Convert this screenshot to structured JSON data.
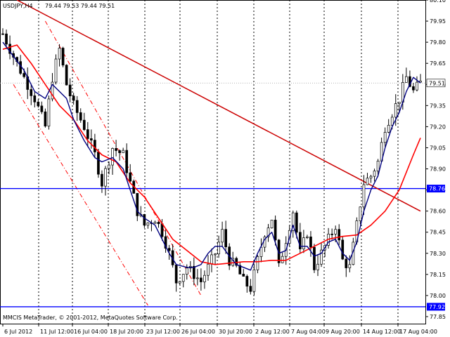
{
  "header": {
    "symbol_label": "USDJPY,H4",
    "ohlc": "79.44 79.53 79.44 79.51"
  },
  "footer": {
    "copyright": "MMCIS MetaTrader, © 2001-2012, MetaQuotes Software Corp."
  },
  "colors": {
    "background": "#ffffff",
    "candle": "#000000",
    "ma_fast": "#000080",
    "ma_slow": "#ff0000",
    "trendline": "#cc0000",
    "hline": "#0000ff",
    "channel": "#ff0000",
    "grid": "#000000"
  },
  "price_tags": {
    "current": "79.51",
    "level_high": "78.76",
    "level_low": "77.92"
  },
  "chart_data": {
    "type": "candlestick",
    "symbol": "USDJPY",
    "timeframe": "H4",
    "ylim": [
      77.8,
      80.1
    ],
    "y_ticks": [
      "80.10",
      "79.95",
      "79.80",
      "79.65",
      "79.50",
      "79.35",
      "79.20",
      "79.05",
      "78.90",
      "78.75",
      "78.60",
      "78.45",
      "78.30",
      "78.15",
      "78.00",
      "77.85"
    ],
    "x_ticks": [
      "6 Jul 2012",
      "11 Jul 12:00",
      "16 Jul 04:00",
      "18 Jul 20:00",
      "23 Jul 12:00",
      "26 Jul 04:00",
      "30 Jul 20:00",
      "2 Aug 12:00",
      "7 Aug 04:00",
      "9 Aug 20:00",
      "14 Aug 12:00",
      "17 Aug 04:00"
    ],
    "horizontal_levels": [
      78.76,
      77.92
    ],
    "current_price": 79.51,
    "close_path": [
      [
        0,
        79.86
      ],
      [
        3,
        79.7
      ],
      [
        6,
        79.55
      ],
      [
        9,
        79.4
      ],
      [
        12,
        79.2
      ],
      [
        14,
        79.55
      ],
      [
        16,
        79.75
      ],
      [
        18,
        79.5
      ],
      [
        20,
        79.35
      ],
      [
        23,
        79.2
      ],
      [
        26,
        79.0
      ],
      [
        28,
        78.8
      ],
      [
        31,
        79.05
      ],
      [
        34,
        79.0
      ],
      [
        36,
        78.8
      ],
      [
        38,
        78.6
      ],
      [
        40,
        78.5
      ],
      [
        43,
        78.55
      ],
      [
        45,
        78.45
      ],
      [
        47,
        78.3
      ],
      [
        49,
        78.1
      ],
      [
        52,
        78.2
      ],
      [
        54,
        78.15
      ],
      [
        56,
        78.1
      ],
      [
        58,
        78.2
      ],
      [
        60,
        78.3
      ],
      [
        62,
        78.45
      ],
      [
        64,
        78.25
      ],
      [
        66,
        78.2
      ],
      [
        68,
        78.1
      ],
      [
        70,
        78.05
      ],
      [
        72,
        78.25
      ],
      [
        74,
        78.45
      ],
      [
        76,
        78.55
      ],
      [
        78,
        78.2
      ],
      [
        80,
        78.4
      ],
      [
        82,
        78.6
      ],
      [
        84,
        78.3
      ],
      [
        86,
        78.45
      ],
      [
        88,
        78.2
      ],
      [
        90,
        78.3
      ],
      [
        92,
        78.4
      ],
      [
        94,
        78.5
      ],
      [
        96,
        78.25
      ],
      [
        98,
        78.2
      ],
      [
        100,
        78.5
      ],
      [
        102,
        78.8
      ],
      [
        104,
        78.85
      ],
      [
        106,
        78.95
      ],
      [
        108,
        79.2
      ],
      [
        110,
        79.3
      ],
      [
        112,
        79.4
      ],
      [
        114,
        79.55
      ],
      [
        116,
        79.45
      ],
      [
        118,
        79.51
      ]
    ],
    "ma_fast": [
      [
        0,
        79.8
      ],
      [
        3,
        79.7
      ],
      [
        6,
        79.6
      ],
      [
        9,
        79.45
      ],
      [
        12,
        79.4
      ],
      [
        14,
        79.5
      ],
      [
        16,
        79.45
      ],
      [
        18,
        79.4
      ],
      [
        20,
        79.25
      ],
      [
        23,
        79.1
      ],
      [
        26,
        78.98
      ],
      [
        28,
        78.95
      ],
      [
        31,
        78.98
      ],
      [
        34,
        78.9
      ],
      [
        36,
        78.75
      ],
      [
        38,
        78.6
      ],
      [
        40,
        78.55
      ],
      [
        43,
        78.5
      ],
      [
        45,
        78.4
      ],
      [
        47,
        78.3
      ],
      [
        49,
        78.22
      ],
      [
        52,
        78.2
      ],
      [
        54,
        78.2
      ],
      [
        56,
        78.22
      ],
      [
        58,
        78.3
      ],
      [
        60,
        78.35
      ],
      [
        62,
        78.35
      ],
      [
        64,
        78.28
      ],
      [
        66,
        78.22
      ],
      [
        68,
        78.2
      ],
      [
        70,
        78.18
      ],
      [
        72,
        78.3
      ],
      [
        74,
        78.4
      ],
      [
        76,
        78.45
      ],
      [
        78,
        78.3
      ],
      [
        80,
        78.32
      ],
      [
        82,
        78.5
      ],
      [
        84,
        78.35
      ],
      [
        86,
        78.35
      ],
      [
        88,
        78.28
      ],
      [
        90,
        78.3
      ],
      [
        92,
        78.38
      ],
      [
        94,
        78.4
      ],
      [
        96,
        78.3
      ],
      [
        98,
        78.25
      ],
      [
        100,
        78.38
      ],
      [
        102,
        78.6
      ],
      [
        104,
        78.75
      ],
      [
        106,
        78.85
      ],
      [
        108,
        79.05
      ],
      [
        110,
        79.2
      ],
      [
        112,
        79.3
      ],
      [
        114,
        79.45
      ],
      [
        116,
        79.55
      ],
      [
        118,
        79.51
      ]
    ],
    "ma_slow": [
      [
        0,
        79.75
      ],
      [
        4,
        79.78
      ],
      [
        8,
        79.65
      ],
      [
        12,
        79.5
      ],
      [
        16,
        79.35
      ],
      [
        20,
        79.25
      ],
      [
        24,
        79.1
      ],
      [
        28,
        79.0
      ],
      [
        32,
        78.95
      ],
      [
        36,
        78.8
      ],
      [
        40,
        78.7
      ],
      [
        44,
        78.55
      ],
      [
        48,
        78.4
      ],
      [
        52,
        78.32
      ],
      [
        56,
        78.24
      ],
      [
        60,
        78.22
      ],
      [
        64,
        78.23
      ],
      [
        68,
        78.24
      ],
      [
        72,
        78.24
      ],
      [
        76,
        78.25
      ],
      [
        80,
        78.25
      ],
      [
        84,
        78.3
      ],
      [
        88,
        78.35
      ],
      [
        92,
        78.4
      ],
      [
        96,
        78.42
      ],
      [
        100,
        78.43
      ],
      [
        104,
        78.5
      ],
      [
        108,
        78.6
      ],
      [
        112,
        78.75
      ],
      [
        116,
        79.0
      ],
      [
        118,
        79.12
      ]
    ],
    "trendline": [
      [
        4,
        80.1
      ],
      [
        118,
        78.6
      ]
    ],
    "channel_lines": [
      [
        [
          12,
          79.95
        ],
        [
          56,
          78.0
        ]
      ],
      [
        [
          3,
          79.5
        ],
        [
          41,
          77.93
        ]
      ]
    ]
  }
}
